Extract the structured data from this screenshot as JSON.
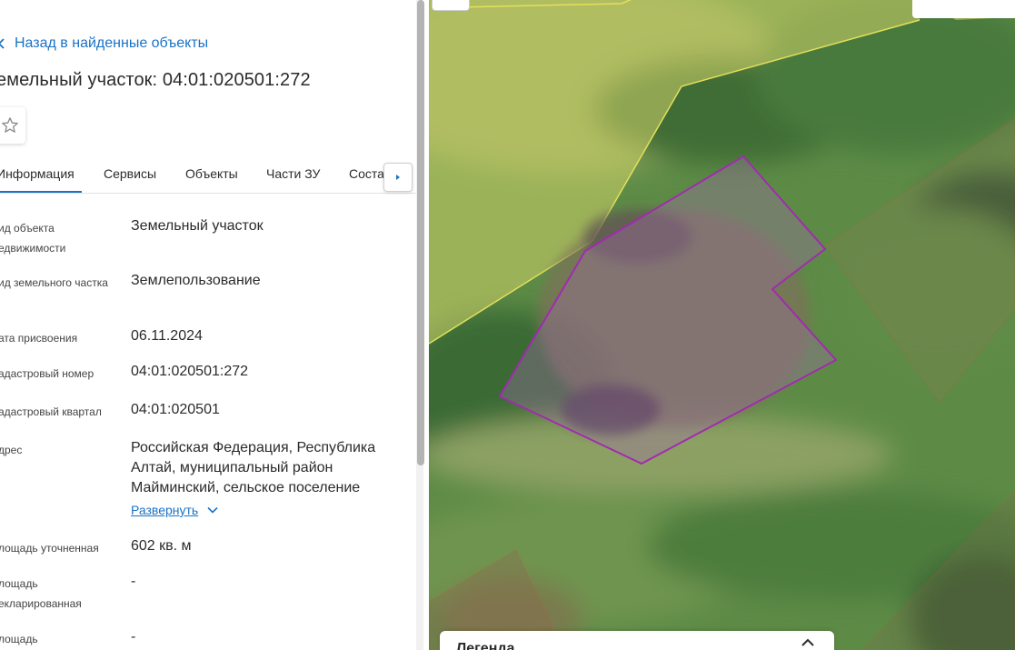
{
  "panel": {
    "back_link": "Назад в найденные объекты",
    "title": "емельный участок: 04:01:020501:272",
    "favorite_icon": "star-icon",
    "tabs": [
      {
        "label": "Информация",
        "active": true
      },
      {
        "label": "Сервисы",
        "active": false
      },
      {
        "label": "Объекты",
        "active": false
      },
      {
        "label": "Части ЗУ",
        "active": false
      },
      {
        "label": "Соста",
        "active": false
      }
    ],
    "tab_scroll_icon": "caret-right-icon",
    "rows": [
      {
        "label": "ид объекта едвижимости",
        "value": "Земельный участок"
      },
      {
        "label": "ид земельного частка",
        "value": "Землепользование"
      },
      {
        "label": "ата присвоения",
        "value": "06.11.2024"
      },
      {
        "label": "адастровый номер",
        "value": "04:01:020501:272"
      },
      {
        "label": "адастровый квартал",
        "value": "04:01:020501"
      },
      {
        "label": "дрес",
        "value": "Российская Федерация, Республика Алтай, муниципальный район Майминский, сельское поселение"
      },
      {
        "label": "лощадь уточненная",
        "value": "602 кв. м"
      },
      {
        "label": "лощадь екларированная",
        "value": "-"
      },
      {
        "label": "лощадь",
        "value": "-"
      }
    ],
    "expand_link": "Развернуть"
  },
  "map": {
    "legend_title": "Легенда",
    "selected_parcel_color": "#a12bb0",
    "zone_outline_color": "#e3e05a",
    "neighbor_outline_color": "#c0563a"
  }
}
